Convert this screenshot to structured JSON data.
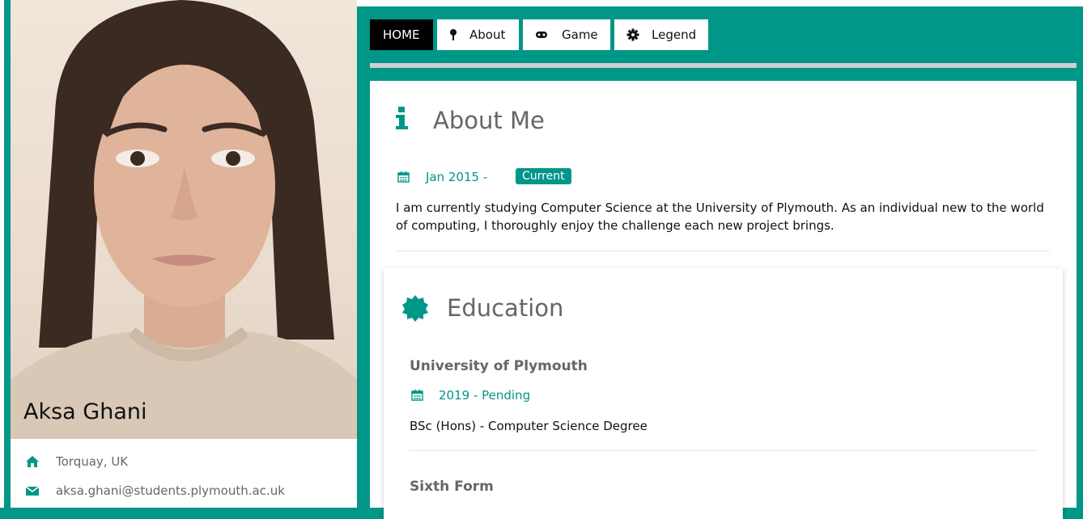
{
  "profile": {
    "name": "Aksa Ghani",
    "location": "Torquay, UK",
    "email": "aksa.ghani@students.plymouth.ac.uk"
  },
  "nav": {
    "items": [
      {
        "label": "HOME",
        "icon": "none",
        "active": true
      },
      {
        "label": "About",
        "icon": "pin-icon",
        "active": false
      },
      {
        "label": "Game",
        "icon": "gamepad-icon",
        "active": false
      },
      {
        "label": "Legend",
        "icon": "gear-icon",
        "active": false
      }
    ]
  },
  "about": {
    "title": "About Me",
    "date": "Jan 2015 -",
    "badge": "Current",
    "text": "I am currently studying Computer Science at the University of Plymouth. As an individual new to the world of computing, I thoroughly enjoy the challenge each new project brings."
  },
  "education": {
    "title": "Education",
    "entries": [
      {
        "school": "University of Plymouth",
        "date": "2019 - Pending",
        "degree": "BSc (Hons) - Computer Science Degree"
      },
      {
        "school": "Sixth Form"
      }
    ]
  },
  "colors": {
    "accent": "#009688",
    "nav_active_bg": "#000000",
    "title_text": "#666666"
  }
}
